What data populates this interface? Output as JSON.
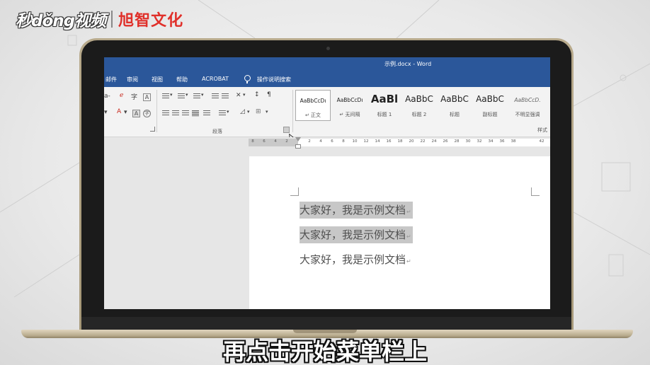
{
  "logo": {
    "brand_left": "秒dǒng视频",
    "brand_right": "旭智文化"
  },
  "window": {
    "title": "示例.docx - Word"
  },
  "tabs": [
    {
      "label": "邮件"
    },
    {
      "label": "审阅"
    },
    {
      "label": "视图"
    },
    {
      "label": "帮助"
    },
    {
      "label": "ACROBAT"
    }
  ],
  "tell_me": {
    "label": "操作说明搜索",
    "icon": "lightbulb-icon"
  },
  "ribbon": {
    "paragraph_group_label": "段落",
    "styles_group_label": "样式",
    "styles": [
      {
        "sample": "AaBbCcDı",
        "name": "↵ 正文",
        "selected": true
      },
      {
        "sample": "AaBbCcDı",
        "name": "↵ 无间隔",
        "selected": false
      },
      {
        "sample": "AaBl",
        "name": "标题 1",
        "selected": false
      },
      {
        "sample": "AaBbC",
        "name": "标题 2",
        "selected": false
      },
      {
        "sample": "AaBbC",
        "name": "标题",
        "selected": false
      },
      {
        "sample": "AaBbC",
        "name": "副标题",
        "selected": false
      },
      {
        "sample": "AaBbCcD.",
        "name": "不明显强调",
        "selected": false
      }
    ]
  },
  "ruler": {
    "left_numbers": [
      "8",
      "6",
      "4",
      "2"
    ],
    "right_numbers": [
      "2",
      "4",
      "6",
      "8",
      "10",
      "12",
      "14",
      "16",
      "18",
      "20",
      "22",
      "24",
      "26",
      "28",
      "30",
      "32",
      "34",
      "36",
      "38",
      "42"
    ]
  },
  "document": {
    "lines": [
      {
        "text": "大家好，我是示例文档",
        "mark": "↵",
        "selected": true
      },
      {
        "text": "大家好，我是示例文档",
        "mark": "↵",
        "selected": true
      },
      {
        "text": "大家好，我是示例文档",
        "mark": "↵",
        "selected": false
      }
    ]
  },
  "subtitle": "再点击开始菜单栏上",
  "colors": {
    "word_blue": "#2b579a",
    "logo_red": "#e0302a",
    "selection_gray": "#c7c7c7"
  }
}
